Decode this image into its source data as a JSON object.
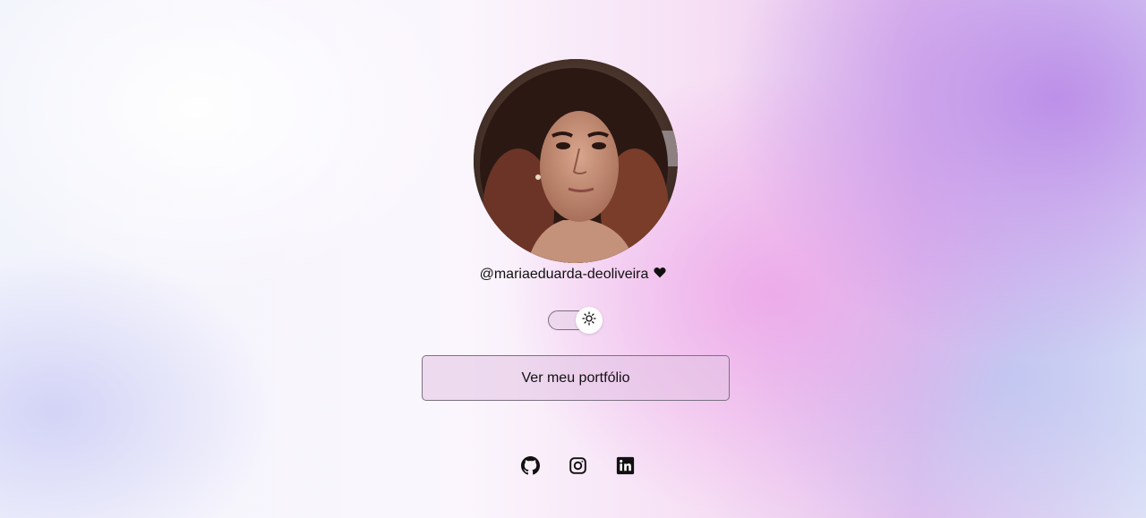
{
  "profile": {
    "avatar_alt": "profile photo",
    "username": "@mariaeduarda-deoliveira",
    "heart_icon": "heart-icon"
  },
  "theme_toggle": {
    "icon": "sun-icon",
    "state": "light"
  },
  "portfolio_button": {
    "label": "Ver meu portfólio"
  },
  "socials": [
    {
      "icon": "github-icon"
    },
    {
      "icon": "instagram-icon"
    },
    {
      "icon": "linkedin-icon"
    }
  ]
}
